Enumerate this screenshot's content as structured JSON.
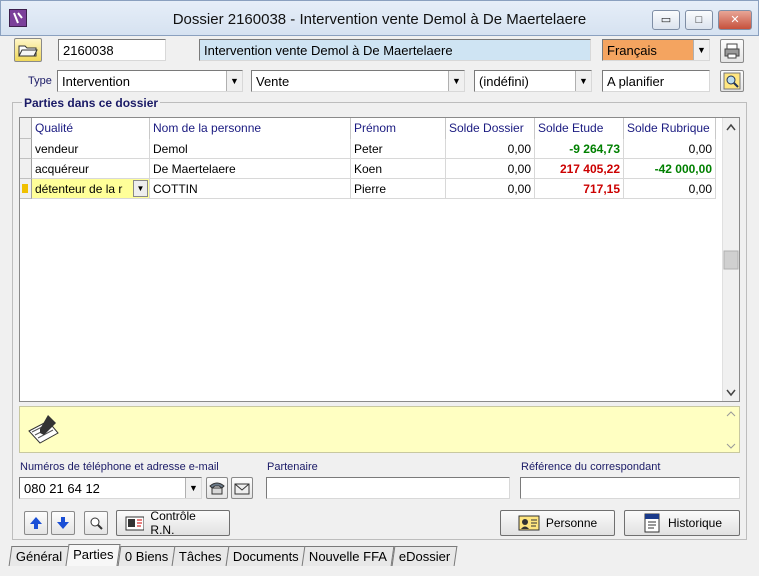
{
  "window": {
    "title": "Dossier 2160038 - Intervention vente Demol à De Maertelaere",
    "min_glyph": "▭",
    "max_glyph": "□",
    "close_glyph": "✕"
  },
  "header": {
    "dossier_number": "2160038",
    "dossier_name": "Intervention vente Demol à De Maertelaere",
    "language": "Français",
    "type_label": "Type",
    "type_value": "Intervention",
    "subtype_value": "Vente",
    "detail_value": "(indéfini)",
    "status_value": "A planifier"
  },
  "parties": {
    "group_title": "Parties dans ce dossier",
    "columns": [
      "Qualité",
      "Nom de la personne",
      "Prénom",
      "Solde Dossier",
      "Solde Etude",
      "Solde Rubrique"
    ],
    "rows": [
      {
        "qualite": "vendeur",
        "nom": "Demol",
        "prenom": "Peter",
        "solde_dossier": "0,00",
        "solde_etude": "-9 264,73",
        "solde_rubrique": "0,00"
      },
      {
        "qualite": "acquéreur",
        "nom": "De Maertelaere",
        "prenom": "Koen",
        "solde_dossier": "0,00",
        "solde_etude": "217 405,22",
        "solde_rubrique": "-42 000,00"
      },
      {
        "qualite": "détenteur de la r",
        "nom": "COTTIN",
        "prenom": "Pierre",
        "solde_dossier": "0,00",
        "solde_etude": "717,15",
        "solde_rubrique": "0,00"
      }
    ],
    "colors": {
      "positive": "#cc0000",
      "negative": "#008000",
      "selected_row": "#ffff99",
      "header_text": "#1a1a80"
    }
  },
  "contact": {
    "phone_label": "Numéros de téléphone et adresse e-mail",
    "phone_value": "080 21 64 12",
    "partner_label": "Partenaire",
    "partner_value": "",
    "reference_label": "Référence du correspondant",
    "reference_value": ""
  },
  "buttons": {
    "controle": "Contrôle R.N.",
    "personne": "Personne",
    "historique": "Historique"
  },
  "tabs": [
    "Général",
    "Parties",
    "0 Biens",
    "Tâches",
    "Documents",
    "Nouvelle FFA",
    "eDossier"
  ],
  "active_tab": "Parties",
  "icons": {
    "folder": "folder-icon",
    "printer": "printer-icon",
    "search": "search-icon",
    "notes": "notepad-icon",
    "up": "arrow-up-icon",
    "down": "arrow-down-icon",
    "zoom": "magnifier-icon",
    "phone": "phone-icon",
    "email": "email-icon",
    "person": "person-icon",
    "history": "history-icon"
  }
}
